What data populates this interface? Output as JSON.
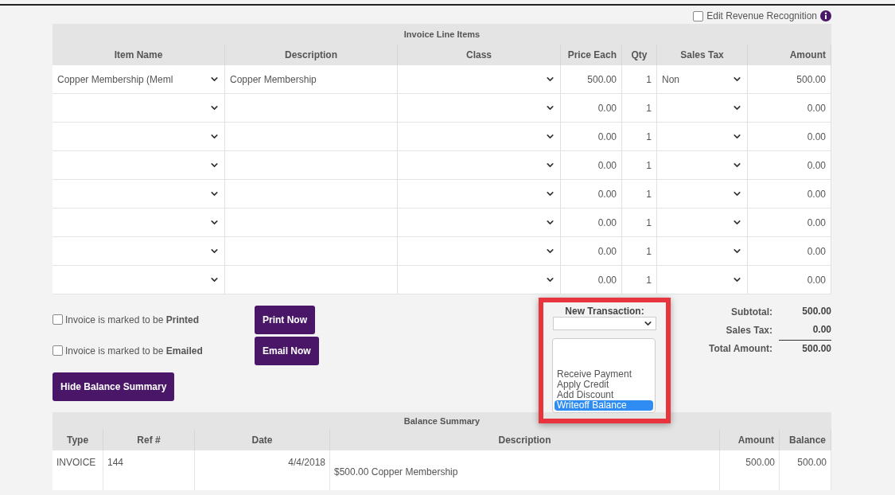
{
  "revenue_recognition": {
    "label": "Edit Revenue Recognition",
    "checked": false
  },
  "line_items": {
    "title": "Invoice Line Items",
    "columns": [
      "Item Name",
      "Description",
      "Class",
      "Price Each",
      "Qty",
      "Sales Tax",
      "Amount"
    ],
    "rows": [
      {
        "item_name": "Copper Membership (Meml",
        "description": "Copper Membership",
        "price": "500.00",
        "qty": "1",
        "sales_tax": "Non",
        "amount": "500.00"
      },
      {
        "price": "0.00",
        "qty": "1",
        "amount": "0.00"
      },
      {
        "price": "0.00",
        "qty": "1",
        "amount": "0.00"
      },
      {
        "price": "0.00",
        "qty": "1",
        "amount": "0.00"
      },
      {
        "price": "0.00",
        "qty": "1",
        "amount": "0.00"
      },
      {
        "price": "0.00",
        "qty": "1",
        "amount": "0.00"
      },
      {
        "price": "0.00",
        "qty": "1",
        "amount": "0.00"
      },
      {
        "price": "0.00",
        "qty": "1",
        "amount": "0.00"
      }
    ]
  },
  "invoice_flags": [
    {
      "text": "Invoice is marked to be **Printed**",
      "checked": false,
      "button": "Print Now"
    },
    {
      "text": "Invoice is marked to be **Emailed**",
      "checked": false,
      "button": "Email Now"
    }
  ],
  "hide_balance_button": "Hide Balance Summary",
  "new_transaction": {
    "label": "New Transaction:",
    "options": [
      {
        "label": "Receive Payment",
        "selected": false
      },
      {
        "label": "Apply Credit",
        "selected": false
      },
      {
        "label": "Add Discount",
        "selected": false
      },
      {
        "label": "Writeoff Balance",
        "selected": true
      }
    ]
  },
  "totals": [
    {
      "label": "Subtotal:",
      "value": "500.00",
      "kind": "line"
    },
    {
      "label": "Sales Tax:",
      "value": "0.00",
      "kind": "line"
    },
    {
      "label": "Total Amount:",
      "value": "500.00",
      "kind": "total"
    }
  ],
  "balance_summary": {
    "title": "Balance Summary",
    "columns": [
      "Type",
      "Ref #",
      "Date",
      "Description",
      "Amount",
      "Balance"
    ],
    "rows": [
      {
        "type": "INVOICE",
        "ref": "144",
        "date": "4/4/2018",
        "description": "$500.00 Copper Membership",
        "amount": "500.00",
        "balance": "500.00"
      }
    ]
  }
}
